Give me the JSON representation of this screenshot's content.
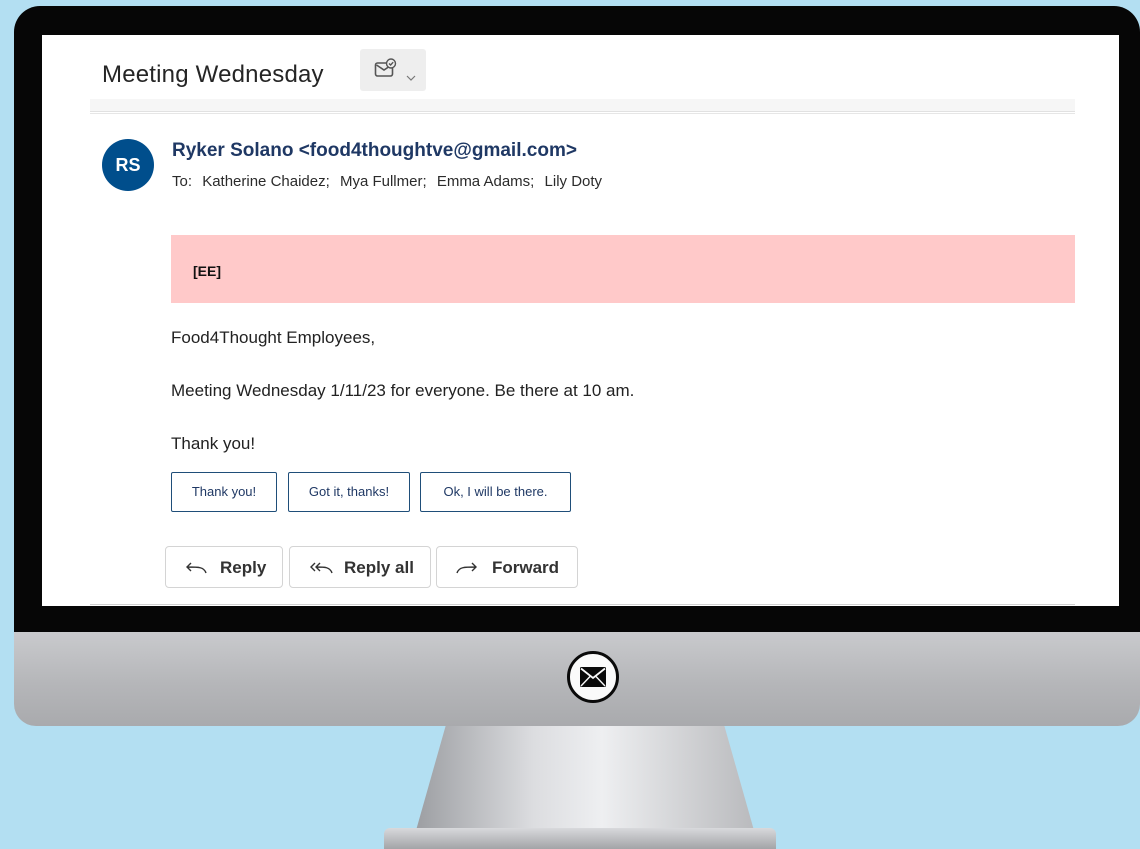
{
  "email": {
    "subject": "Meeting Wednesday",
    "avatar_initials": "RS",
    "sender": "Ryker Solano <food4thoughtve@gmail.com>",
    "to_label": "To:",
    "recipients": [
      "Katherine Chaidez;",
      "Mya Fullmer;",
      "Emma Adams;",
      "Lily Doty"
    ],
    "banner": "[EE]",
    "body": [
      "Food4Thought Employees,",
      "Meeting Wednesday 1/11/23 for everyone. Be there at 10 am.",
      "Thank you!"
    ]
  },
  "quick_replies": [
    "Thank you!",
    "Got it, thanks!",
    "Ok, I will be there."
  ],
  "actions": {
    "reply": "Reply",
    "reply_all": "Reply all",
    "forward": "Forward"
  },
  "icons": {
    "subject_tag": "mail-tag-icon",
    "subject_tag_chevron": "chevron-down-icon",
    "reply": "reply-arrow-icon",
    "reply_all": "reply-all-arrow-icon",
    "forward": "forward-arrow-icon",
    "monitor_logo": "envelope-icon"
  },
  "colors": {
    "background": "#b3dff2",
    "avatar": "#004e8c",
    "sender_text": "#1f3864",
    "banner": "#ffc9c9",
    "quick_reply_border": "#1f4e79"
  }
}
